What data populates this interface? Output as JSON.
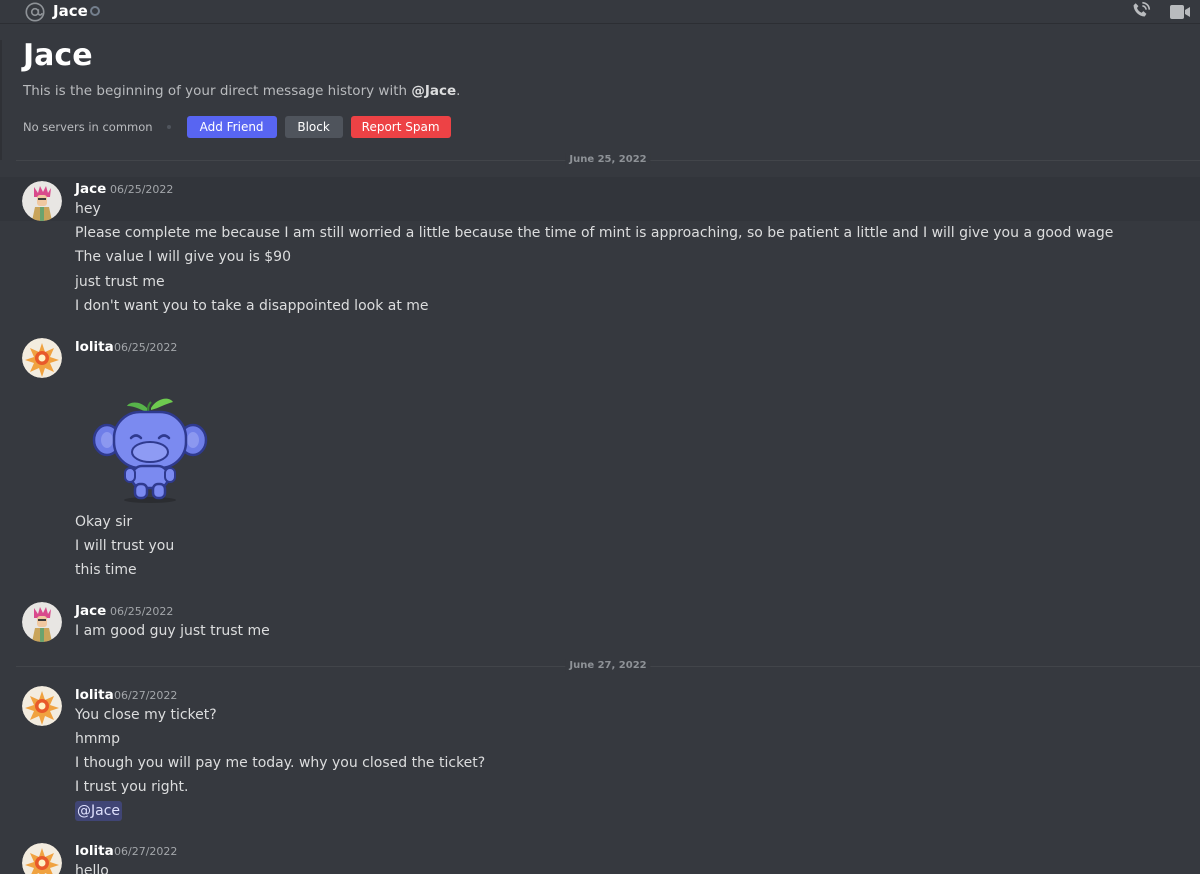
{
  "header": {
    "title": "Jace",
    "icons": [
      "at-icon",
      "status-dot",
      "phone-call-icon",
      "video-call-icon"
    ]
  },
  "intro": {
    "name": "Jace",
    "description_prefix": "This is the beginning of your direct message history with ",
    "description_mention": "@Jace",
    "description_suffix": ".",
    "no_servers": "No servers in common",
    "buttons": {
      "add_friend": "Add Friend",
      "block": "Block",
      "report_spam": "Report Spam"
    }
  },
  "dividers": [
    "June 25, 2022",
    "June 27, 2022"
  ],
  "colors": {
    "background": "#36393f",
    "blurple": "#5865f2",
    "block_grey": "#4f545c",
    "danger_red": "#ed4245"
  },
  "messages": [
    {
      "author": "Jace",
      "timestamp": "06/25/2022",
      "lines": [
        "hey",
        "Please complete me because I am still worried a little because the time of mint is approaching, so be patient a little and I will give you a good wage",
        "The value I will give you is $90",
        "just trust me",
        "I don't want you to take a disappointed look at me"
      ]
    },
    {
      "author": "lolita",
      "timestamp": "06/25/2022",
      "sticker": "wumpus-sticker",
      "lines": [
        "Okay sir",
        "I will trust you",
        "this time"
      ]
    },
    {
      "author": "Jace",
      "timestamp": "06/25/2022",
      "lines": [
        "I am good guy just trust me"
      ]
    },
    {
      "author": "lolita",
      "timestamp": "06/27/2022",
      "lines": [
        "You close my ticket?",
        "hmmp",
        "I though you will pay me today. why you closed the ticket?",
        "I trust you right."
      ],
      "mention": "@Jace"
    },
    {
      "author": "lolita",
      "timestamp": "06/27/2022",
      "lines": [
        "hello"
      ]
    }
  ]
}
